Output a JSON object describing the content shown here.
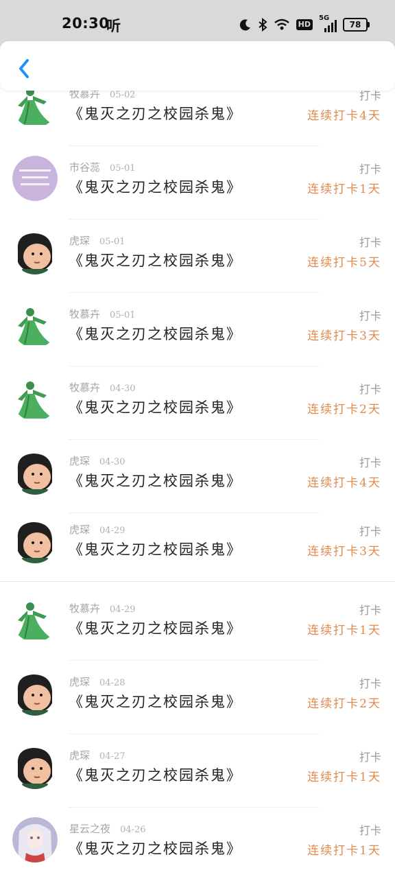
{
  "status_bar": {
    "time": "20:30",
    "listen_icon_text": "听",
    "network": "5G",
    "hd": "HD",
    "battery": "78"
  },
  "header": {
    "back_icon": "chevron-left-icon",
    "accent": "#1e90ff"
  },
  "records": [
    {
      "user": "牧慕卉",
      "date": "05-02",
      "book": "《鬼灭之刃之校园杀鬼》",
      "status": "打卡",
      "streak": "连续打卡4天",
      "avatar": "green-figure"
    },
    {
      "user": "市谷蕊",
      "date": "05-01",
      "book": "《鬼灭之刃之校园杀鬼》",
      "status": "打卡",
      "streak": "连续打卡1天",
      "avatar": "purple-text"
    },
    {
      "user": "虎琛",
      "date": "05-01",
      "book": "《鬼灭之刃之校园杀鬼》",
      "status": "打卡",
      "streak": "连续打卡5天",
      "avatar": "cartoon-face"
    },
    {
      "user": "牧慕卉",
      "date": "05-01",
      "book": "《鬼灭之刃之校园杀鬼》",
      "status": "打卡",
      "streak": "连续打卡3天",
      "avatar": "green-figure"
    },
    {
      "user": "牧慕卉",
      "date": "04-30",
      "book": "《鬼灭之刃之校园杀鬼》",
      "status": "打卡",
      "streak": "连续打卡2天",
      "avatar": "green-figure"
    },
    {
      "user": "虎琛",
      "date": "04-30",
      "book": "《鬼灭之刃之校园杀鬼》",
      "status": "打卡",
      "streak": "连续打卡4天",
      "avatar": "cartoon-face"
    },
    {
      "user": "虎琛",
      "date": "04-29",
      "book": "《鬼灭之刃之校园杀鬼》",
      "status": "打卡",
      "streak": "连续打卡3天",
      "avatar": "cartoon-face"
    },
    {
      "user": "牧慕卉",
      "date": "04-29",
      "book": "《鬼灭之刃之校园杀鬼》",
      "status": "打卡",
      "streak": "连续打卡1天",
      "avatar": "green-figure"
    },
    {
      "user": "虎琛",
      "date": "04-28",
      "book": "《鬼灭之刃之校园杀鬼》",
      "status": "打卡",
      "streak": "连续打卡2天",
      "avatar": "cartoon-face"
    },
    {
      "user": "虎琛",
      "date": "04-27",
      "book": "《鬼灭之刃之校园杀鬼》",
      "status": "打卡",
      "streak": "连续打卡1天",
      "avatar": "cartoon-face"
    },
    {
      "user": "星云之夜",
      "date": "04-26",
      "book": "《鬼灭之刃之校园杀鬼》",
      "status": "打卡",
      "streak": "连续打卡1天",
      "avatar": "anime-girl"
    }
  ],
  "colors": {
    "streak": "#e08a4c",
    "meta": "#a5a5a5",
    "title": "#222222"
  }
}
